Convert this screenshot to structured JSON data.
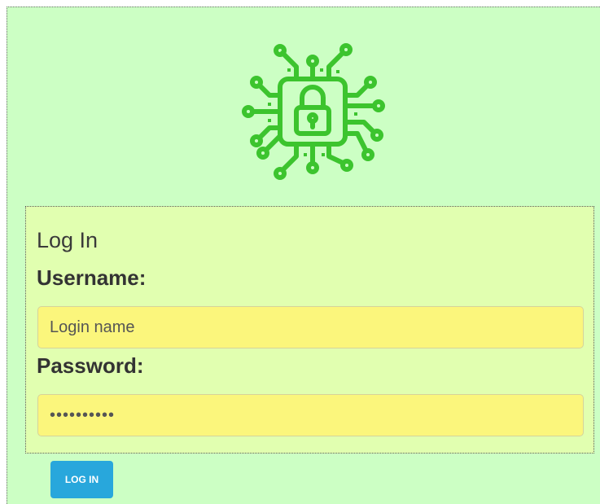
{
  "logo": {
    "icon": "chip-lock-icon",
    "color": "#3cc42e"
  },
  "login": {
    "title": "Log In",
    "username_label": "Username:",
    "username_placeholder": "Login name",
    "password_label": "Password:",
    "password_value": "••••••••••",
    "submit_label": "LOG IN"
  },
  "colors": {
    "background": "#ccffc4",
    "panel": "#e1ffb0",
    "input": "#fbf67c",
    "button": "#28a7dc"
  }
}
